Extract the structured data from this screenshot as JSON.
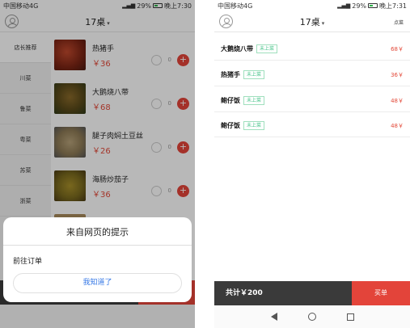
{
  "status_left": {
    "carrier": "中国移动4G",
    "battery": "29%",
    "time": "晚上7:30"
  },
  "status_right": {
    "carrier": "中国移动4G",
    "battery": "29%",
    "time": "晚上7:31"
  },
  "header": {
    "table": "17桌",
    "caret": "▾",
    "order_link": "点菜"
  },
  "categories": [
    "店长推荐",
    "川菜",
    "鲁菜",
    "粤菜",
    "苏菜",
    "浙菜"
  ],
  "dishes": [
    {
      "name": "热猪手",
      "price": "￥36",
      "qty": "0"
    },
    {
      "name": "大鹅烧八带",
      "price": "￥68",
      "qty": "0"
    },
    {
      "name": "腿子肉焖土豆丝",
      "price": "￥26",
      "qty": "0"
    },
    {
      "name": "海肠炒茄子",
      "price": "￥36",
      "qty": "0"
    }
  ],
  "dialog": {
    "title": "来自网页的提示",
    "message": "前往订单",
    "button": "我知道了"
  },
  "orders": [
    {
      "name": "大鹅烧八带",
      "status": "未上菜",
      "price": "68￥"
    },
    {
      "name": "热猪手",
      "status": "未上菜",
      "price": "36￥"
    },
    {
      "name": "鲍仔饭",
      "status": "未上菜",
      "price": "48￥"
    },
    {
      "name": "鲍仔饭",
      "status": "未上菜",
      "price": "48￥"
    }
  ],
  "cart": {
    "total": "共计￥200",
    "checkout": "买单"
  },
  "colors": {
    "accent": "#e3443a",
    "badge": "#48c48a",
    "cart_bar": "#3a3a3a"
  }
}
